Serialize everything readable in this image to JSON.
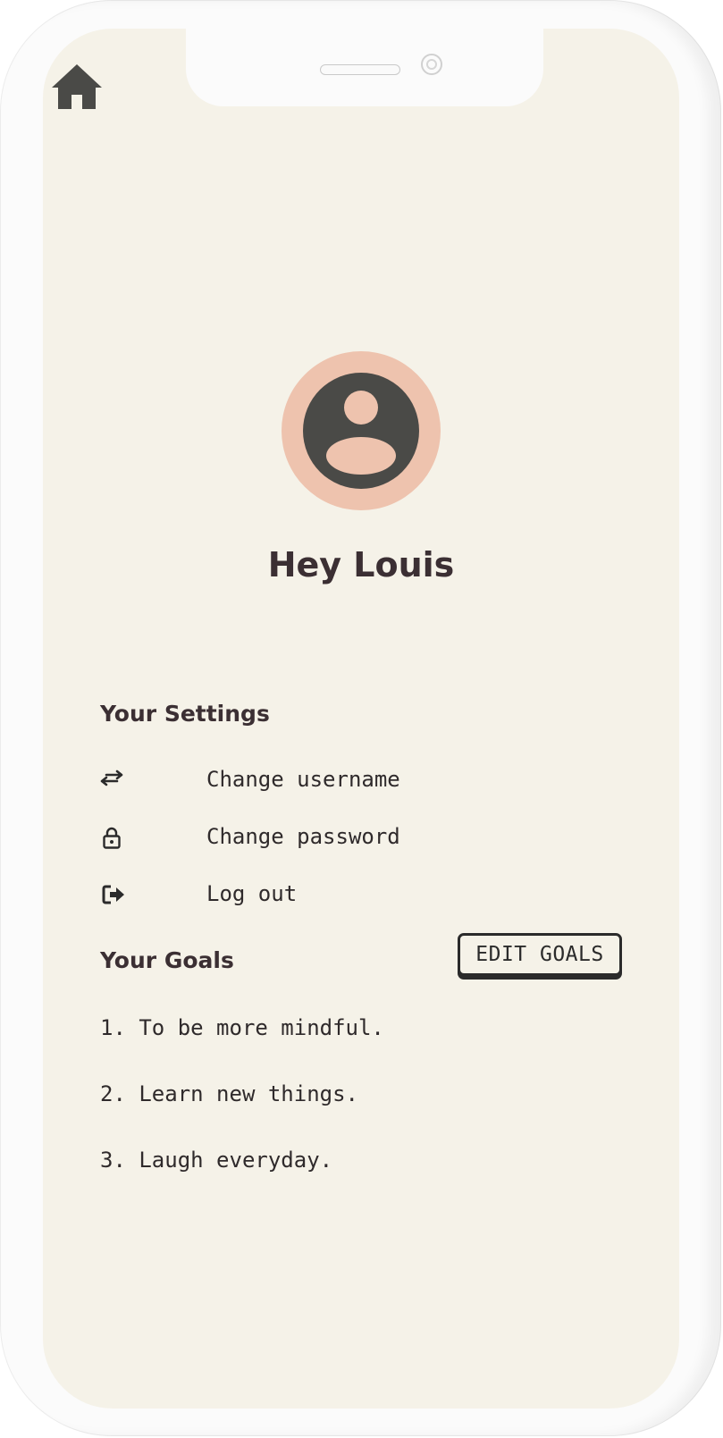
{
  "header": {
    "home_icon": "home-icon"
  },
  "profile": {
    "avatar_icon": "user-circle-icon",
    "greeting": "Hey Louis"
  },
  "settings": {
    "title": "Your Settings",
    "items": [
      {
        "icon": "swap-arrows-icon",
        "label": "Change username"
      },
      {
        "icon": "lock-icon",
        "label": "Change password"
      },
      {
        "icon": "logout-icon",
        "label": "Log out"
      }
    ]
  },
  "goals": {
    "title": "Your Goals",
    "edit_label": "EDIT GOALS",
    "items": [
      "1. To be more mindful.",
      "2. Learn new things.",
      "3. Laugh everyday."
    ]
  },
  "colors": {
    "background": "#f5f2e8",
    "avatar_ring": "#eec3ae",
    "avatar_fill": "#4a4a47",
    "text_dark": "#3b2f33"
  }
}
